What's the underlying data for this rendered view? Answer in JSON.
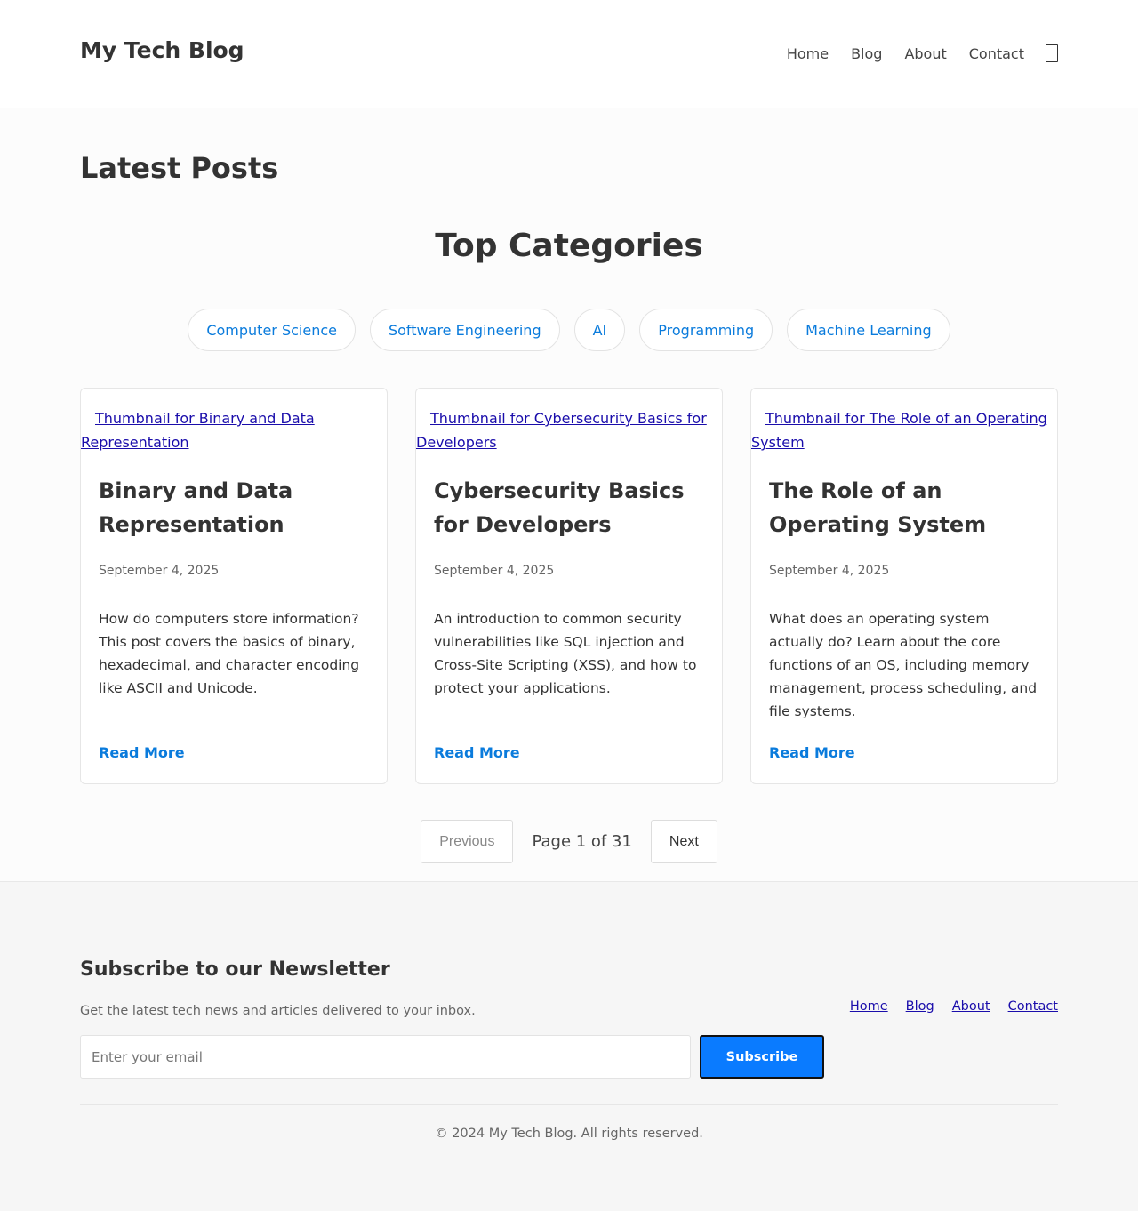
{
  "header": {
    "site_title": "My Tech Blog",
    "nav": [
      "Home",
      "Blog",
      "About",
      "Contact"
    ],
    "toggle_icon": "theme-toggle-icon"
  },
  "main": {
    "heading": "Latest Posts",
    "categories_heading": "Top Categories",
    "categories": [
      "Computer Science",
      "Software Engineering",
      "AI",
      "Programming",
      "Machine Learning"
    ],
    "posts": [
      {
        "thumb_alt": "Thumbnail for Binary and Data Representation",
        "title": "Binary and Data Representation",
        "date": "September 4, 2025",
        "excerpt": "How do computers store information? This post covers the basics of binary, hexadecimal, and character encoding like ASCII and Unicode.",
        "read_more": "Read More"
      },
      {
        "thumb_alt": "Thumbnail for Cybersecurity Basics for Developers",
        "title": "Cybersecurity Basics for Developers",
        "date": "September 4, 2025",
        "excerpt": "An introduction to common security vulnerabilities like SQL injection and Cross-Site Scripting (XSS), and how to protect your applications.",
        "read_more": "Read More"
      },
      {
        "thumb_alt": "Thumbnail for The Role of an Operating System",
        "title": "The Role of an Operating System",
        "date": "September 4, 2025",
        "excerpt": "What does an operating system actually do? Learn about the core functions of an OS, including memory management, process scheduling, and file systems.",
        "read_more": "Read More"
      }
    ],
    "pagination": {
      "previous": "Previous",
      "info": "Page 1 of 31",
      "next": "Next"
    }
  },
  "footer": {
    "newsletter_title": "Subscribe to our Newsletter",
    "newsletter_desc": "Get the latest tech news and articles delivered to your inbox.",
    "email_placeholder": "Enter your email",
    "subscribe_label": "Subscribe",
    "links": [
      "Home",
      "Blog",
      "About",
      "Contact"
    ],
    "copyright": "© 2024 My Tech Blog. All rights reserved."
  },
  "colors": {
    "accent": "#0a7bdc",
    "button": "#0a7bff"
  }
}
